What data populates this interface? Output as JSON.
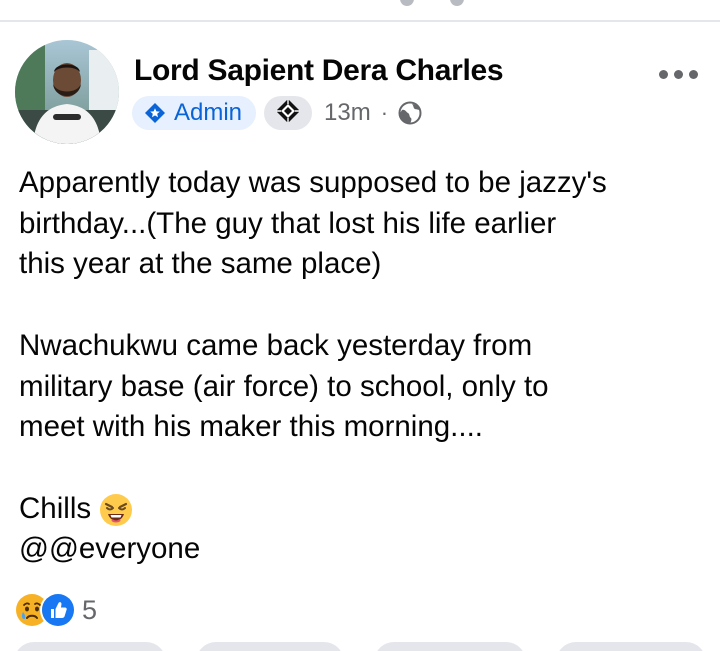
{
  "post": {
    "author": "Lord Sapient Dera Charles",
    "badge_label": "Admin",
    "timestamp": "13m",
    "separator": "·",
    "audience_icon": "globe-icon",
    "paragraphs": [
      [
        "Apparently today was supposed to be jazzy's",
        "birthday...(The guy that lost his life earlier",
        "this year at the same place)"
      ],
      [
        "Nwachukwu came back yesterday from",
        "military base (air force) to school, only to",
        "meet with his maker this morning...."
      ]
    ],
    "closing_line": "Chills",
    "closing_emoji": "weary-face-emoji",
    "mention_line": "@@everyone"
  },
  "reactions": {
    "icons": [
      "sad-reaction-icon",
      "like-reaction-icon"
    ],
    "count": "5"
  },
  "colors": {
    "admin_badge_bg": "#e7f0fe",
    "admin_badge_text": "#0a64d8",
    "meta_text": "#65676b",
    "like_blue": "#1877f2",
    "divider": "#e4e6eb"
  }
}
